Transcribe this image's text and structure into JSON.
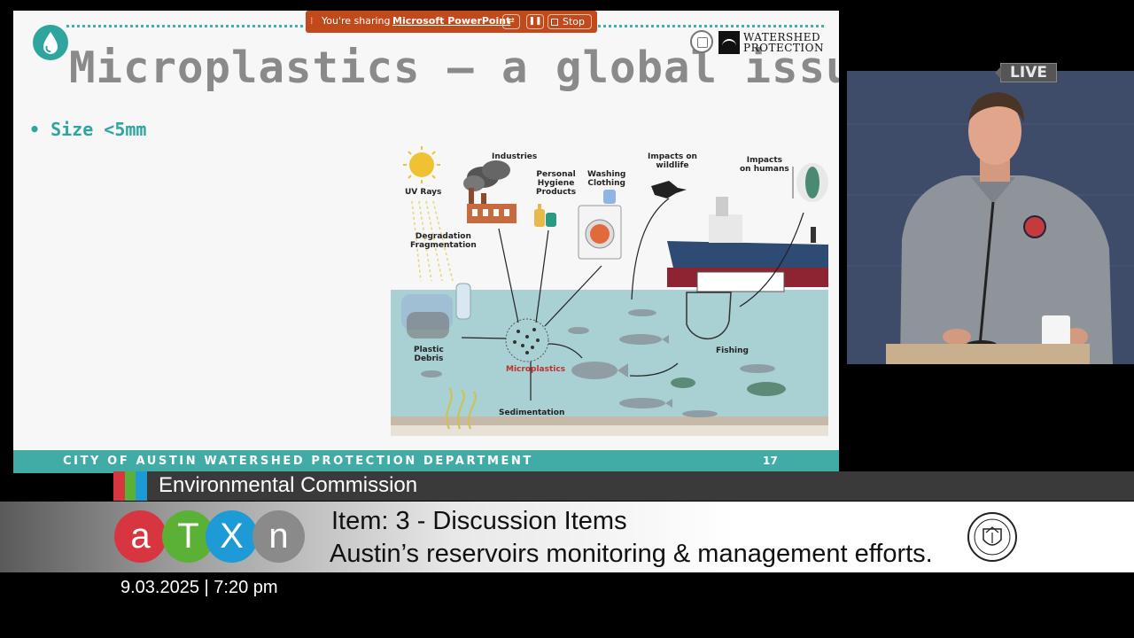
{
  "slide": {
    "title": "Microplastics – a global issue",
    "bullet": "• Size <5mm",
    "logo_text_line1": "WATERSHED",
    "logo_text_line2": "PROTECTION",
    "footer": "CITY OF AUSTIN WATERSHED PROTECTION DEPARTMENT",
    "page_number": "17",
    "theme_color": "#41aba5",
    "title_color": "#8a8a8a"
  },
  "diagram": {
    "labels": {
      "uv_rays": "UV Rays",
      "industries": "Industries",
      "hygiene_1": "Personal",
      "hygiene_2": "Hygiene",
      "hygiene_3": "Products",
      "washing_1": "Washing",
      "washing_2": "Clothing",
      "wildlife_1": "Impacts on",
      "wildlife_2": "wildlife",
      "humans_1": "Impacts",
      "humans_2": "on humans",
      "degradation_1": "Degradation",
      "degradation_2": "Fragmentation",
      "plastic_1": "Plastic",
      "plastic_2": "Debris",
      "microplastics": "Microplastics",
      "fishing": "Fishing",
      "sedimentation": "Sedimentation"
    }
  },
  "share_banner": {
    "prefix": "You're sharing",
    "app": "Microsoft PowerPoint",
    "stop_label": "Stop",
    "color": "#c2491b"
  },
  "video": {
    "live_label": "LIVE"
  },
  "broadcast": {
    "commission": "Environmental Commission",
    "logo_letters": [
      "a",
      "T",
      "X",
      "n"
    ],
    "logo_colors": [
      "#d7353f",
      "#5bb135",
      "#1e9ad6",
      "#8a8a8a"
    ],
    "item_title": "Item: 3 - Discussion Items",
    "item_subtitle": "Austin’s reservoirs monitoring & management efforts.",
    "date": "9.03.2025 | 7:20 pm"
  }
}
